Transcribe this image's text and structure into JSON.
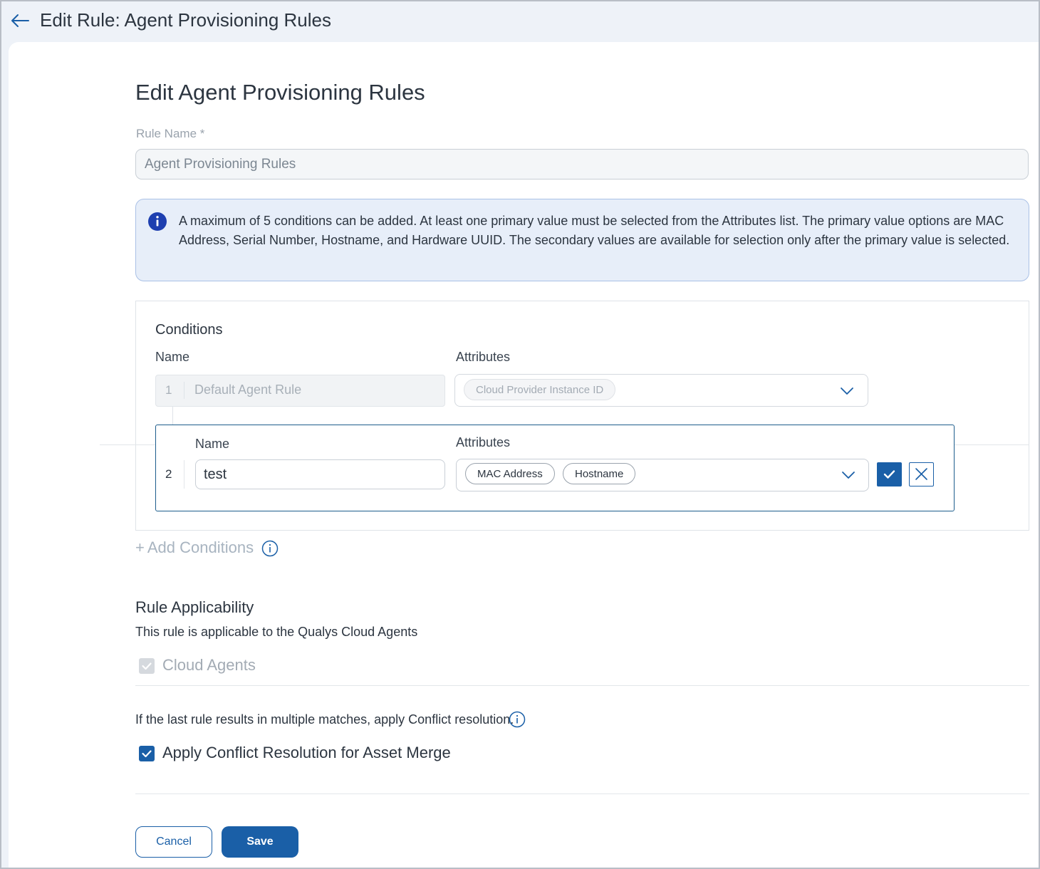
{
  "header": {
    "title": "Edit Rule: Agent Provisioning Rules"
  },
  "form": {
    "title": "Edit Agent Provisioning Rules",
    "rule_name_label": "Rule Name *",
    "rule_name_value": "Agent Provisioning Rules",
    "info_message": "A maximum of 5 conditions can be added. At least one primary value must be selected from the Attributes list. The primary value options are MAC Address, Serial Number, Hostname, and Hardware UUID. The secondary values are available for selection only after the primary value is selected."
  },
  "conditions": {
    "title": "Conditions",
    "name_label": "Name",
    "attributes_label": "Attributes",
    "rows": [
      {
        "number": "1",
        "name": "Default Agent Rule",
        "attributes": [
          "Cloud Provider Instance ID"
        ],
        "editable": false
      },
      {
        "number": "2",
        "name": "test",
        "attributes": [
          "MAC Address",
          "Hostname"
        ],
        "editable": true
      }
    ],
    "add_label": "Add Conditions"
  },
  "applicability": {
    "title": "Rule Applicability",
    "subtitle": "This rule is applicable to the Qualys Cloud Agents",
    "cloud_agents_label": "Cloud Agents",
    "cloud_agents_checked": true,
    "cloud_agents_disabled": true
  },
  "conflict": {
    "text": "If the last rule results in multiple matches, apply Conflict resolution.",
    "checkbox_label": "Apply Conflict Resolution for Asset Merge",
    "checked": true
  },
  "actions": {
    "cancel_label": "Cancel",
    "save_label": "Save"
  },
  "colors": {
    "primary": "#1a5fa7",
    "info_bg": "#e7eef9",
    "info_icon": "#1e3fb0"
  }
}
